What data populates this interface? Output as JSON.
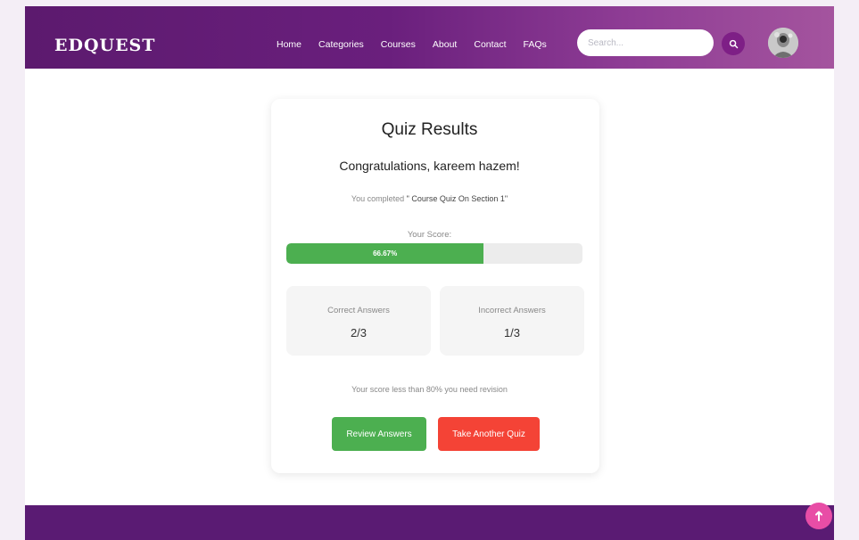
{
  "navbar": {
    "brand": "EDQUEST",
    "links": [
      "Home",
      "Categories",
      "Courses",
      "About",
      "Contact",
      "FAQs"
    ],
    "search_placeholder": "Search...",
    "search_icon": "search-icon",
    "avatar_icon": "user-avatar"
  },
  "quiz": {
    "title": "Quiz Results",
    "congrats": "Congratulations, kareem hazem!",
    "completed_prefix": "You completed",
    "quiz_name": "\" Course Quiz On Section 1\"",
    "score_label": "Your Score:",
    "score_percent": 66.67,
    "score_text": "66.67%",
    "correct_label": "Correct Answers",
    "correct_value": "2/3",
    "incorrect_label": "Incorrect Answers",
    "incorrect_value": "1/3",
    "message": "Your score less than 80% you need revision",
    "review_button": "Review Answers",
    "another_button": "Take Another Quiz"
  },
  "colors": {
    "nav_gradient_start": "#5c1a6e",
    "nav_gradient_end": "#a4549e",
    "progress_fill": "#4caf50",
    "review_button": "#4caf50",
    "another_button": "#f44336",
    "footer": "#5a1b73",
    "scroll_top_button": "#e84da6"
  },
  "scroll_top_icon": "arrow-up-icon"
}
